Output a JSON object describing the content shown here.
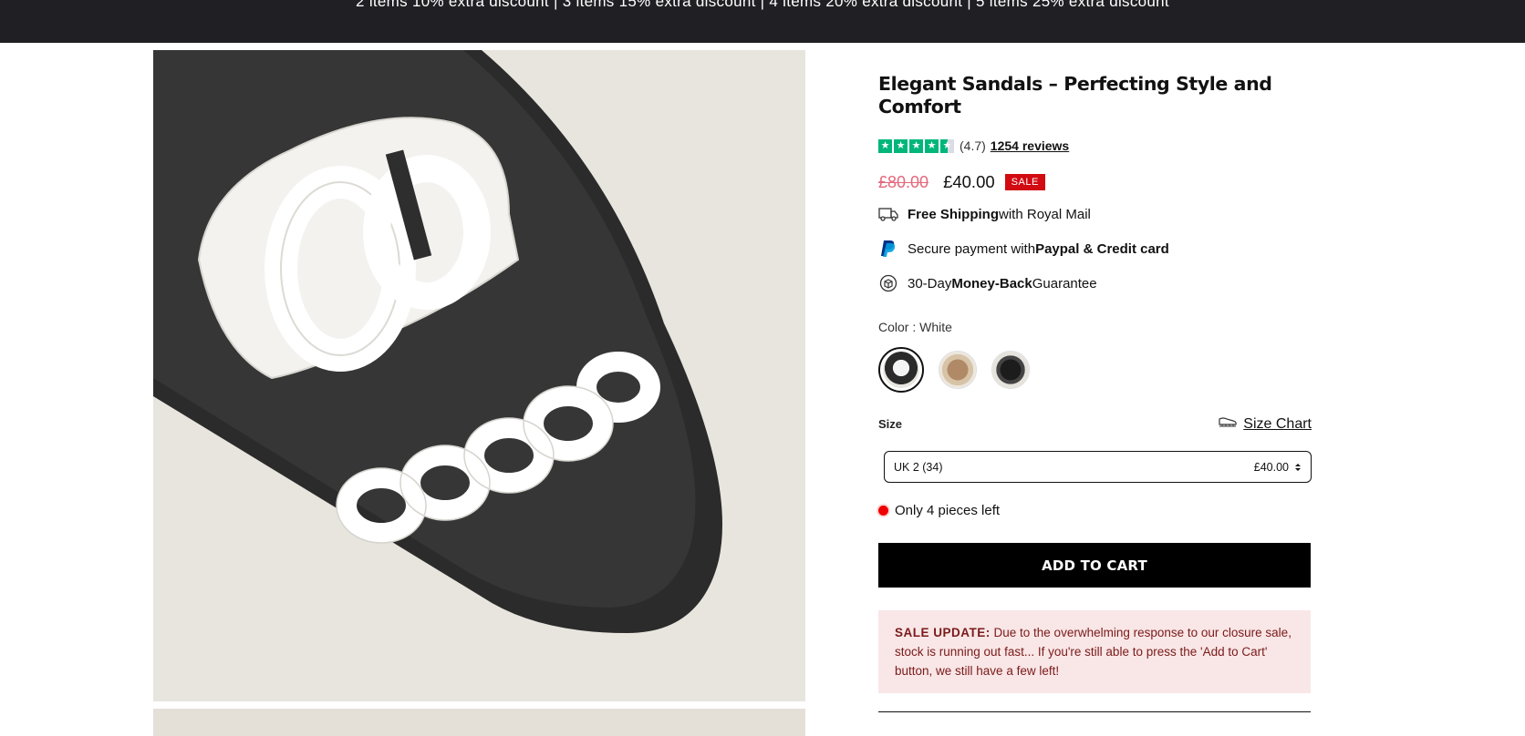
{
  "announcement": "2 items 10% extra discount | 3 items 15% extra discount | 4 items 20% extra discount | 5 items 25% extra discount",
  "product": {
    "title": "Elegant Sandals – Perfecting Style and Comfort",
    "rating_value": "(4.7)",
    "rating_stars": 4.7,
    "reviews_label": "1254 reviews",
    "old_price": "£80.00",
    "new_price": "£40.00",
    "sale_badge": "SALE"
  },
  "features": {
    "shipping_bold": "Free Shipping",
    "shipping_rest": " with Royal Mail",
    "payment_pre": "Secure payment with ",
    "payment_bold": "Paypal & Credit card",
    "guarantee_pre": "30-Day ",
    "guarantee_bold": "Money-Back",
    "guarantee_rest": " Guarantee"
  },
  "color": {
    "label": "Color : White",
    "options": [
      "white-swatch",
      "tan-swatch",
      "black-swatch"
    ]
  },
  "size": {
    "label": "Size",
    "chart_label": "Size Chart",
    "selected": "UK 2 (34)",
    "selected_price": "£40.00"
  },
  "stock": "Only 4 pieces left",
  "cart": {
    "button": "ADD TO CART"
  },
  "notice": {
    "heading": "SALE UPDATE:",
    "body": " Due to the overwhelming response to our closure sale, stock is running out fast... If you're still able to press the 'Add to Cart' button, we still have a few left!"
  },
  "colors": {
    "topbar": "#1f1f24",
    "trustpilot_green": "#00b67a",
    "sale_red": "#d20a11",
    "old_price_pink": "#e5687d",
    "notice_bg": "#f9e6e6"
  }
}
